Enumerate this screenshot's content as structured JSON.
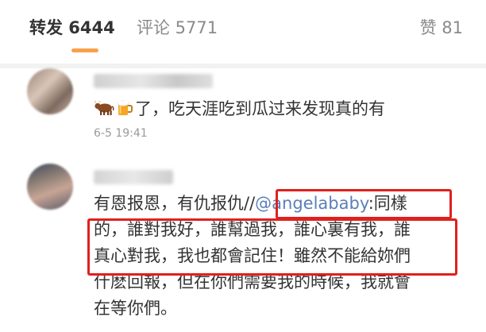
{
  "tabs": {
    "repost": "转发 6444",
    "comment": "评论 5771",
    "like": "赞 81",
    "active": "repost",
    "accent_color": "#f7a24a"
  },
  "comments": [
    {
      "emojis": [
        "ox-emoji",
        "beer-mug-emoji"
      ],
      "text": "了，吃天涯吃到瓜过来发现真的有",
      "time": "6-5 19:41"
    },
    {
      "lines": [
        {
          "before": "有恩报恩，有仇报仇//",
          "mention": "@angelababy",
          "after": ":同樣"
        },
        {
          "text": "的，誰對我好，誰幫過我，誰心裏有我，誰"
        },
        {
          "text": "真心對我，我也都會記住！雖然不能給妳們"
        },
        {
          "text": "什麽回報，但在你們需要我的時候，我就會"
        },
        {
          "text": "在等你們。"
        }
      ],
      "mention_color": "#5b7fb8"
    }
  ],
  "annotations": {
    "highlight_color": "#e0201d"
  }
}
